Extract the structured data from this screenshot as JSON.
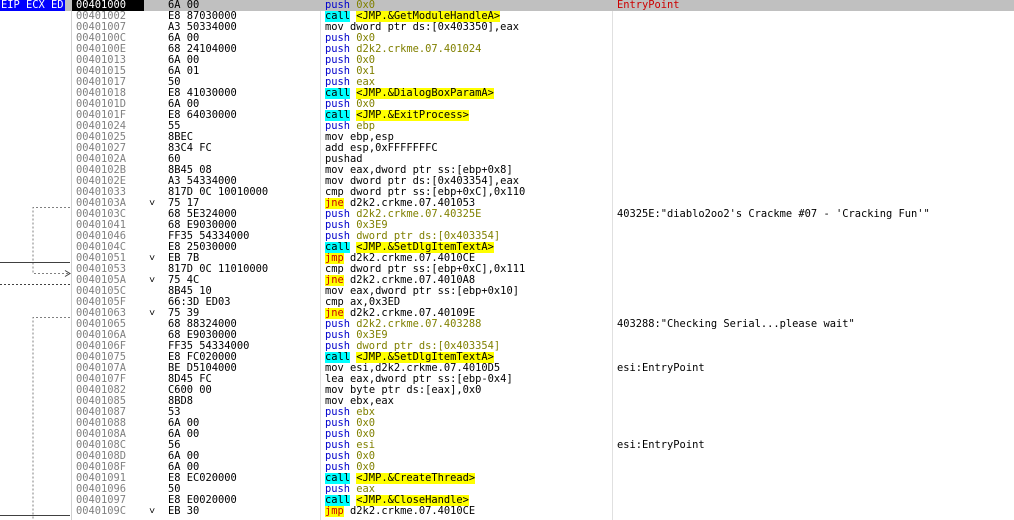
{
  "register_label": "EIP ECX ED",
  "rows": [
    {
      "addr": "00401000",
      "mark": "",
      "bytes": "6A 00",
      "mn": "push",
      "op": "0x0",
      "cmt": "EntryPoint",
      "eip": true
    },
    {
      "addr": "00401002",
      "mark": "",
      "bytes": "E8 87030000",
      "mn": "call",
      "op": "<JMP.&GetModuleHandleA>",
      "cmt": ""
    },
    {
      "addr": "00401007",
      "mark": "",
      "bytes": "A3 50334000",
      "mn": "mov",
      "op": "dword ptr ds:[0x403350],eax",
      "cmt": ""
    },
    {
      "addr": "0040100C",
      "mark": "",
      "bytes": "6A 00",
      "mn": "push",
      "op": "0x0",
      "cmt": ""
    },
    {
      "addr": "0040100E",
      "mark": "",
      "bytes": "68 24104000",
      "mn": "push",
      "op": "d2k2.crkme.07.401024",
      "cmt": ""
    },
    {
      "addr": "00401013",
      "mark": "",
      "bytes": "6A 00",
      "mn": "push",
      "op": "0x0",
      "cmt": ""
    },
    {
      "addr": "00401015",
      "mark": "",
      "bytes": "6A 01",
      "mn": "push",
      "op": "0x1",
      "cmt": ""
    },
    {
      "addr": "00401017",
      "mark": "",
      "bytes": "50",
      "mn": "push",
      "op": "eax",
      "cmt": ""
    },
    {
      "addr": "00401018",
      "mark": "",
      "bytes": "E8 41030000",
      "mn": "call",
      "op": "<JMP.&DialogBoxParamA>",
      "cmt": ""
    },
    {
      "addr": "0040101D",
      "mark": "",
      "bytes": "6A 00",
      "mn": "push",
      "op": "0x0",
      "cmt": ""
    },
    {
      "addr": "0040101F",
      "mark": "",
      "bytes": "E8 64030000",
      "mn": "call",
      "op": "<JMP.&ExitProcess>",
      "cmt": ""
    },
    {
      "addr": "00401024",
      "mark": "",
      "bytes": "55",
      "mn": "push",
      "op": "ebp",
      "cmt": ""
    },
    {
      "addr": "00401025",
      "mark": "",
      "bytes": "8BEC",
      "mn": "mov",
      "op": "ebp,esp",
      "cmt": ""
    },
    {
      "addr": "00401027",
      "mark": "",
      "bytes": "83C4 FC",
      "mn": "add",
      "op": "esp,0xFFFFFFFC",
      "cmt": ""
    },
    {
      "addr": "0040102A",
      "mark": "",
      "bytes": "60",
      "mn": "pushad",
      "op": "",
      "cmt": ""
    },
    {
      "addr": "0040102B",
      "mark": "",
      "bytes": "8B45 08",
      "mn": "mov",
      "op": "eax,dword ptr ss:[ebp+0x8]",
      "cmt": ""
    },
    {
      "addr": "0040102E",
      "mark": "",
      "bytes": "A3 54334000",
      "mn": "mov",
      "op": "dword ptr ds:[0x403354],eax",
      "cmt": ""
    },
    {
      "addr": "00401033",
      "mark": "",
      "bytes": "817D 0C 10010000",
      "mn": "cmp",
      "op": "dword ptr ss:[ebp+0xC],0x110",
      "cmt": ""
    },
    {
      "addr": "0040103A",
      "mark": "˅",
      "bytes": "75 17",
      "mn": "jne",
      "op": "d2k2.crkme.07.401053",
      "cmt": ""
    },
    {
      "addr": "0040103C",
      "mark": "",
      "bytes": "68 5E324000",
      "mn": "push",
      "op": "d2k2.crkme.07.40325E",
      "cmt": "40325E:\"diablo2oo2's Crackme #07 - 'Cracking Fun'\""
    },
    {
      "addr": "00401041",
      "mark": "",
      "bytes": "68 E9030000",
      "mn": "push",
      "op": "0x3E9",
      "cmt": ""
    },
    {
      "addr": "00401046",
      "mark": "",
      "bytes": "FF35 54334000",
      "mn": "push",
      "op": "dword ptr ds:[0x403354]",
      "cmt": ""
    },
    {
      "addr": "0040104C",
      "mark": "",
      "bytes": "E8 25030000",
      "mn": "call",
      "op": "<JMP.&SetDlgItemTextA>",
      "cmt": ""
    },
    {
      "addr": "00401051",
      "mark": "˅",
      "bytes": "EB 7B",
      "mn": "jmp",
      "op": "d2k2.crkme.07.4010CE",
      "cmt": ""
    },
    {
      "addr": "00401053",
      "mark": "",
      "bytes": "817D 0C 11010000",
      "mn": "cmp",
      "op": "dword ptr ss:[ebp+0xC],0x111",
      "cmt": ""
    },
    {
      "addr": "0040105A",
      "mark": "˅",
      "bytes": "75 4C",
      "mn": "jne",
      "op": "d2k2.crkme.07.4010A8",
      "cmt": ""
    },
    {
      "addr": "0040105C",
      "mark": "",
      "bytes": "8B45 10",
      "mn": "mov",
      "op": "eax,dword ptr ss:[ebp+0x10]",
      "cmt": ""
    },
    {
      "addr": "0040105F",
      "mark": "",
      "bytes": "66:3D ED03",
      "mn": "cmp",
      "op": "ax,0x3ED",
      "cmt": ""
    },
    {
      "addr": "00401063",
      "mark": "˅",
      "bytes": "75 39",
      "mn": "jne",
      "op": "d2k2.crkme.07.40109E",
      "cmt": ""
    },
    {
      "addr": "00401065",
      "mark": "",
      "bytes": "68 88324000",
      "mn": "push",
      "op": "d2k2.crkme.07.403288",
      "cmt": "403288:\"Checking Serial...please wait\""
    },
    {
      "addr": "0040106A",
      "mark": "",
      "bytes": "68 E9030000",
      "mn": "push",
      "op": "0x3E9",
      "cmt": ""
    },
    {
      "addr": "0040106F",
      "mark": "",
      "bytes": "FF35 54334000",
      "mn": "push",
      "op": "dword ptr ds:[0x403354]",
      "cmt": ""
    },
    {
      "addr": "00401075",
      "mark": "",
      "bytes": "E8 FC020000",
      "mn": "call",
      "op": "<JMP.&SetDlgItemTextA>",
      "cmt": ""
    },
    {
      "addr": "0040107A",
      "mark": "",
      "bytes": "BE D5104000",
      "mn": "mov",
      "op": "esi,d2k2.crkme.07.4010D5",
      "cmt": "esi:EntryPoint"
    },
    {
      "addr": "0040107F",
      "mark": "",
      "bytes": "8D45 FC",
      "mn": "lea",
      "op": "eax,dword ptr ss:[ebp-0x4]",
      "cmt": ""
    },
    {
      "addr": "00401082",
      "mark": "",
      "bytes": "C600 00",
      "mn": "mov",
      "op": "byte ptr ds:[eax],0x0",
      "cmt": ""
    },
    {
      "addr": "00401085",
      "mark": "",
      "bytes": "8BD8",
      "mn": "mov",
      "op": "ebx,eax",
      "cmt": ""
    },
    {
      "addr": "00401087",
      "mark": "",
      "bytes": "53",
      "mn": "push",
      "op": "ebx",
      "cmt": ""
    },
    {
      "addr": "00401088",
      "mark": "",
      "bytes": "6A 00",
      "mn": "push",
      "op": "0x0",
      "cmt": ""
    },
    {
      "addr": "0040108A",
      "mark": "",
      "bytes": "6A 00",
      "mn": "push",
      "op": "0x0",
      "cmt": ""
    },
    {
      "addr": "0040108C",
      "mark": "",
      "bytes": "56",
      "mn": "push",
      "op": "esi",
      "cmt": "esi:EntryPoint"
    },
    {
      "addr": "0040108D",
      "mark": "",
      "bytes": "6A 00",
      "mn": "push",
      "op": "0x0",
      "cmt": ""
    },
    {
      "addr": "0040108F",
      "mark": "",
      "bytes": "6A 00",
      "mn": "push",
      "op": "0x0",
      "cmt": ""
    },
    {
      "addr": "00401091",
      "mark": "",
      "bytes": "E8 EC020000",
      "mn": "call",
      "op": "<JMP.&CreateThread>",
      "cmt": ""
    },
    {
      "addr": "00401096",
      "mark": "",
      "bytes": "50",
      "mn": "push",
      "op": "eax",
      "cmt": ""
    },
    {
      "addr": "00401097",
      "mark": "",
      "bytes": "E8 E0020000",
      "mn": "call",
      "op": "<JMP.&CloseHandle>",
      "cmt": ""
    },
    {
      "addr": "0040109C",
      "mark": "˅",
      "bytes": "EB 30",
      "mn": "jmp",
      "op": "d2k2.crkme.07.4010CE",
      "cmt": ""
    }
  ],
  "colors": {
    "eip_row": "#c0c0c0",
    "register_label_bg": "#0000ff",
    "address_current_bg": "#000000",
    "address_text": "#808080",
    "call_highlight": "#00ffff",
    "jump_highlight": "#ffff00",
    "jump_text": "#cc0000",
    "push_text": "#0000cc",
    "comment_entry": "#cc0000"
  }
}
